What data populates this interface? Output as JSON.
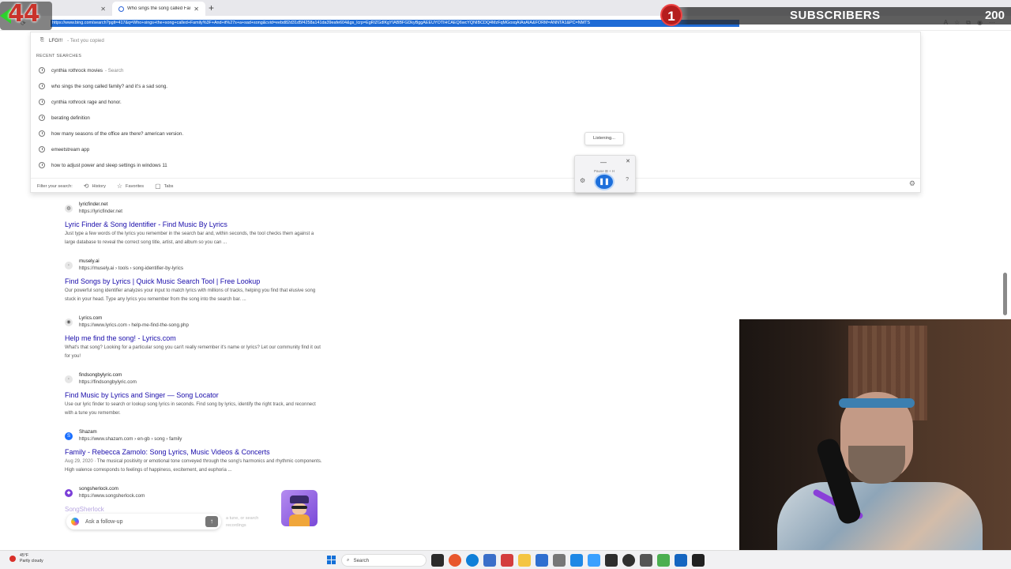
{
  "counter": {
    "value": "44"
  },
  "tabs": [
    {
      "label": "",
      "active": false
    },
    {
      "label": "Who sings the song called Family",
      "active": true
    }
  ],
  "address": {
    "url": "https://www.bing.com/search?pglt=417&q=Who+sings+the+song+called+Family%3F+And+it%27s+a+sad+song&cvid=eebd82d31d5f4258a141da39eafe604&gs_lcrp=EgRlZGdlKgYIABBFGDkyBggAEEUYOTIHCAEQ6wcYQNIBCDQ4MzFqMGoxqAIAsAIA&FORM=ANNTA1&PC=NMTS"
  },
  "subscribers": {
    "badge": "1",
    "label": "SUBSCRIBERS",
    "count": "200"
  },
  "dropdown": {
    "copied_text": "LFG!!!",
    "copied_sub": "- Text you copied",
    "section_title": "RECENT SEARCHES",
    "items": [
      {
        "text": "cynthia rothrock movies",
        "sub": "- Search"
      },
      {
        "text": "who sings the song called family? and it's a sad song.",
        "sub": ""
      },
      {
        "text": "cynthia rothrock rage and honor.",
        "sub": ""
      },
      {
        "text": "berating definition",
        "sub": ""
      },
      {
        "text": "how many seasons of the office are there? american version.",
        "sub": ""
      },
      {
        "text": "emeetstream app",
        "sub": ""
      },
      {
        "text": "how to adjust power and sleep settings in windows 11",
        "sub": ""
      }
    ],
    "filter_placeholder": "Filter your search:",
    "filters": [
      "History",
      "Favorites",
      "Tabs"
    ]
  },
  "voice": {
    "listening_label": "Listening...",
    "hint": "Pause ⊞ + H"
  },
  "results": [
    {
      "site": "lyricfinder.net",
      "url": "https://lyricfinder.net",
      "title": "Lyric Finder & Song Identifier - Find Music By Lyrics",
      "date": "",
      "snippet": "Just type a few words of the lyrics you remember in the search bar and, within seconds, the tool checks them against a large database to reveal the correct song title, artist, and album so you can ..."
    },
    {
      "site": "musely.ai",
      "url": "https://musely.ai › tools › song-identifier-by-lyrics",
      "title": "Find Songs by Lyrics | Quick Music Search Tool | Free Lookup",
      "date": "",
      "snippet": "Our powerful song identifier analyzes your input to match lyrics with millions of tracks, helping you find that elusive song stuck in your head. Type any lyrics you remember from the song into the search bar. ..."
    },
    {
      "site": "Lyrics.com",
      "url": "https://www.lyrics.com › help-me-find-the-song.php",
      "title": "Help me find the song! - Lyrics.com",
      "date": "",
      "snippet": "What's that song? Looking for a particular song you can't really remember it's name or lyrics? Let our community find it out for you!"
    },
    {
      "site": "findsongbylyric.com",
      "url": "https://findsongbylyric.com",
      "title": "Find Music by Lyrics and Singer — Song Locator",
      "date": "",
      "snippet": "Use our lyric finder to search or lookup song lyrics in seconds. Find song by lyrics, identify the right track, and reconnect with a tune you remember."
    },
    {
      "site": "Shazam",
      "url": "https://www.shazam.com › en-gb › song › family",
      "title": "Family - Rebecca Zamolo: Song Lyrics, Music Videos & Concerts",
      "date": "Aug 29, 2020",
      "snippet": " · The musical positivity or emotional tone conveyed through the song's harmonics and rhythmic components. High valence corresponds to feelings of happiness, excitement, and euphoria ..."
    },
    {
      "site": "songsherlock.com",
      "url": "https://www.songsherlock.com",
      "title": "",
      "date": "",
      "snippet": ""
    }
  ],
  "faded": {
    "title": "SongSherlock",
    "text_line1": "a tune, or search",
    "text_line2": "recordings"
  },
  "followup": {
    "placeholder": "Ask a follow-up"
  },
  "taskbar": {
    "weather_temp": "45°F",
    "weather_desc": "Partly cloudy",
    "search_label": "Search"
  }
}
